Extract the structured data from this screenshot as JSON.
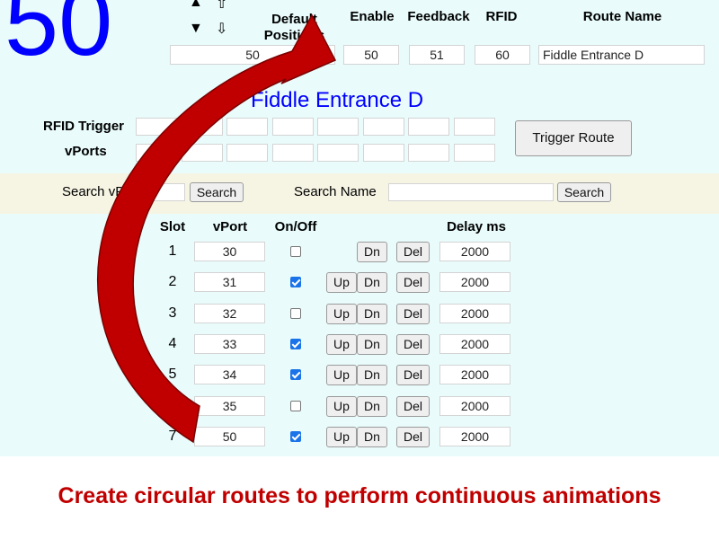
{
  "route_number": "50",
  "nav": {
    "up_icon": "triangle-up",
    "down_icon": "triangle-down",
    "up_hollow_icon": "hollow-arrow-up",
    "down_hollow_icon": "hollow-arrow-down"
  },
  "headers": {
    "default": "Default Positions",
    "enable": "Enable",
    "feedback": "Feedback",
    "rfid": "RFID",
    "route_name": "Route Name"
  },
  "fields": {
    "default": "50",
    "enable": "50",
    "feedback": "51",
    "rfid": "60",
    "route_name": "Fiddle Entrance D"
  },
  "title": "Fiddle Entrance D",
  "rfid_trigger_label": "RFID Trigger",
  "vports_label": "vPorts",
  "trigger_button": "Trigger Route",
  "search": {
    "vport_label": "Search vPort",
    "vport_button": "Search",
    "name_label": "Search Name",
    "name_button": "Search"
  },
  "table": {
    "headers": {
      "slot": "Slot",
      "vport": "vPort",
      "onoff": "On/Off",
      "delay": "Delay ms"
    },
    "buttons": {
      "up": "Up",
      "dn": "Dn",
      "del": "Del"
    },
    "rows": [
      {
        "slot": "1",
        "vport": "30",
        "on": false,
        "delay": "2000"
      },
      {
        "slot": "2",
        "vport": "31",
        "on": true,
        "delay": "2000"
      },
      {
        "slot": "3",
        "vport": "32",
        "on": false,
        "delay": "2000"
      },
      {
        "slot": "4",
        "vport": "33",
        "on": true,
        "delay": "2000"
      },
      {
        "slot": "5",
        "vport": "34",
        "on": true,
        "delay": "2000"
      },
      {
        "slot": "6",
        "vport": "35",
        "on": false,
        "delay": "2000"
      },
      {
        "slot": "7",
        "vport": "50",
        "on": true,
        "delay": "2000"
      }
    ]
  },
  "colors": {
    "accent_blue": "#0000ff",
    "arrow_red": "#c00000",
    "caption_red": "#c00000"
  },
  "caption": "Create circular routes to perform continuous animations"
}
